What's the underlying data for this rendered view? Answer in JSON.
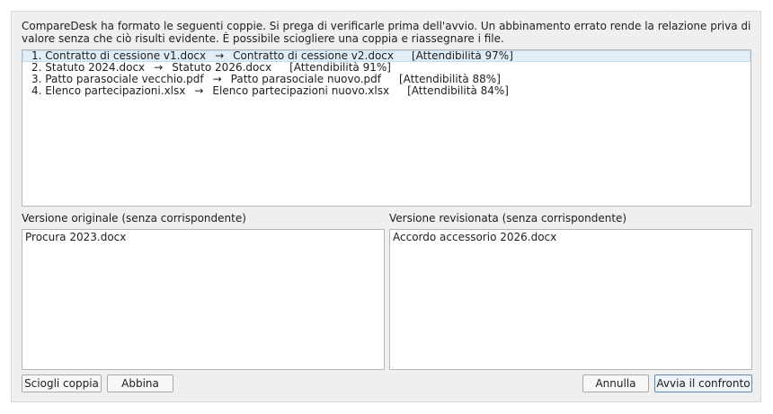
{
  "dialog": {
    "intro": "CompareDesk ha formato le seguenti coppie. Si prega di verificarle prima dell'avvio. Un abbinamento errato rende la relazione priva di valore senza che ciò risulti evidente. È possibile sciogliere una coppia e riassegnare i file."
  },
  "pairs": [
    {
      "index": "1.",
      "left": "Contratto di cessione v1.docx",
      "arrow": "→",
      "right": "Contratto di cessione v2.docx",
      "confidence": "[Attendibilità 97%]"
    },
    {
      "index": "2.",
      "left": "Statuto 2024.docx",
      "arrow": "→",
      "right": "Statuto 2026.docx",
      "confidence": "[Attendibilità 91%]"
    },
    {
      "index": "3.",
      "left": "Patto parasociale vecchio.pdf",
      "arrow": "→",
      "right": "Patto parasociale nuovo.pdf",
      "confidence": "[Attendibilità 88%]"
    },
    {
      "index": "4.",
      "left": "Elenco partecipazioni.xlsx",
      "arrow": "→",
      "right": "Elenco partecipazioni nuovo.xlsx",
      "confidence": "[Attendibilità 84%]"
    }
  ],
  "unmatched": {
    "original_label": "Versione originale (senza corrispondente)",
    "original_files": [
      "Procura 2023.docx"
    ],
    "revised_label": "Versione revisionata (senza corrispondente)",
    "revised_files": [
      "Accordo accessorio 2026.docx"
    ]
  },
  "buttons": {
    "unpair": "Sciogli coppia",
    "pair": "Abbina",
    "cancel": "Annulla",
    "start": "Avvia il confronto"
  }
}
